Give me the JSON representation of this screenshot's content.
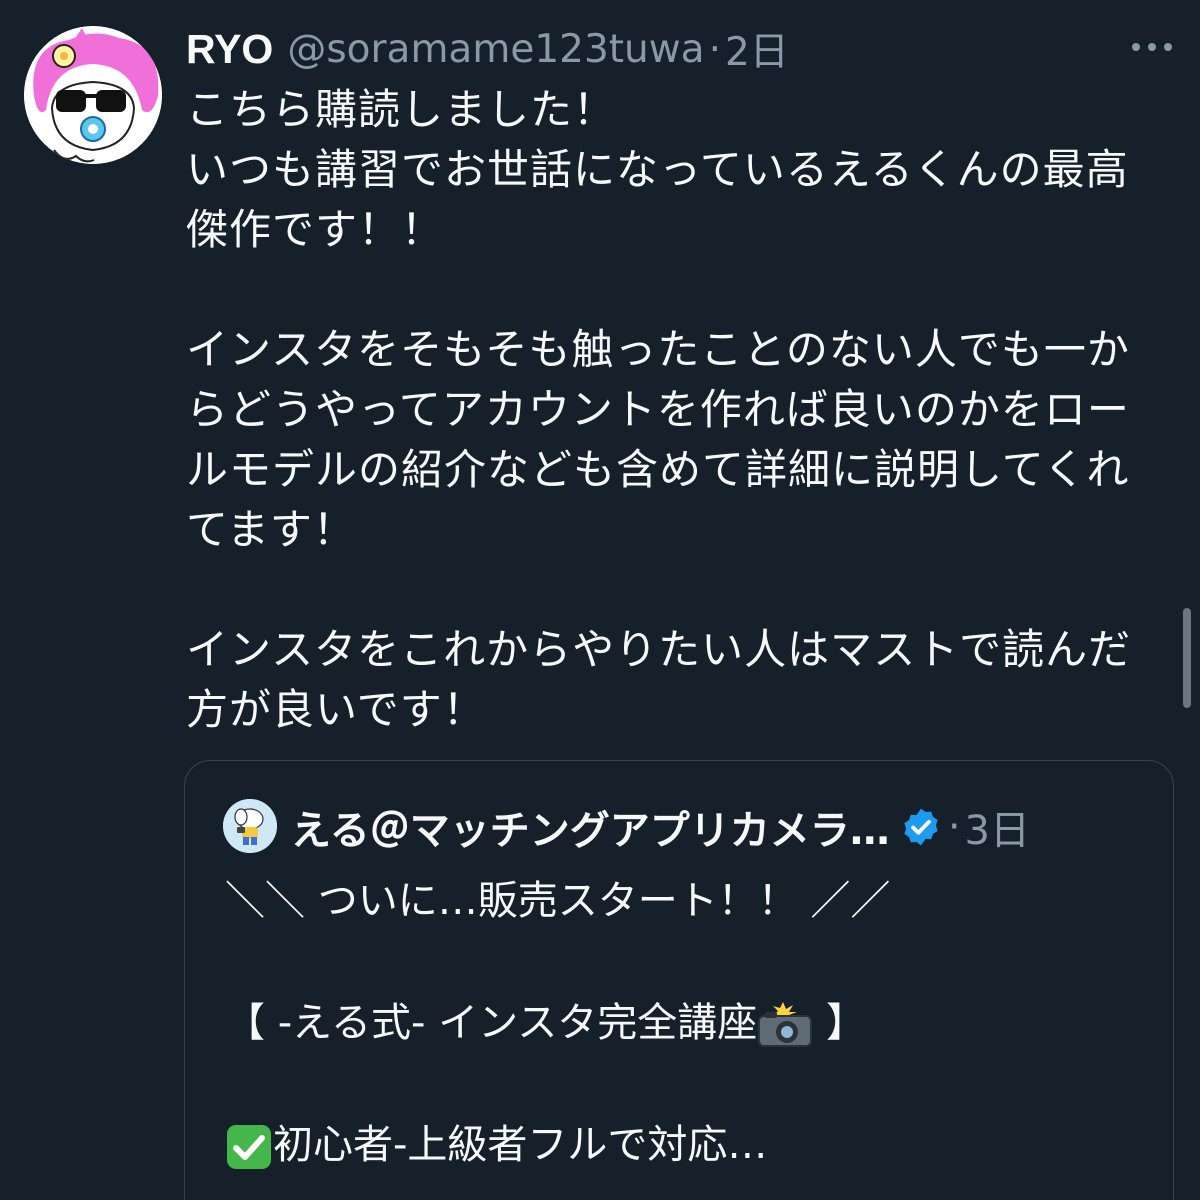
{
  "tweet": {
    "display_name": "RYO",
    "handle": "@soramame123tuwa",
    "separator": "·",
    "time": "2日",
    "more_icon": "more-horizontal-icon",
    "lines": [
      "こちら購読しました！",
      "いつも講習でお世話になっているえるくんの最高",
      "傑作です！！",
      "",
      "インスタをそもそも触ったことのない人でも一か",
      "らどうやってアカウントを作れば良いのかをロー",
      "ルモデルの紹介なども含めて詳細に説明してくれ",
      "てます！",
      "",
      "インスタをこれからやりたい人はマストで読んだ",
      "方が良いです！"
    ]
  },
  "quote": {
    "display_name": "える＠マッチングアプリカメラ…",
    "verified_icon": "verified-badge-icon",
    "separator": "·",
    "time": "3日",
    "line1": "＼＼ ついに…販売スタート！！ ／／",
    "line2_prefix": "【 -える式- インスタ完全講座",
    "line2_emoji": "camera-flash-icon",
    "line2_suffix": " 】",
    "line3_emoji": "check-mark-button-icon",
    "line3_text": "初心者-上級者フルで対応…"
  },
  "colors": {
    "background": "#15202b",
    "text": "#f7f9f9",
    "secondary_text": "#8b98a5",
    "border": "#38444d",
    "verified": "#1d9bf0",
    "check_green": "#45b649"
  }
}
